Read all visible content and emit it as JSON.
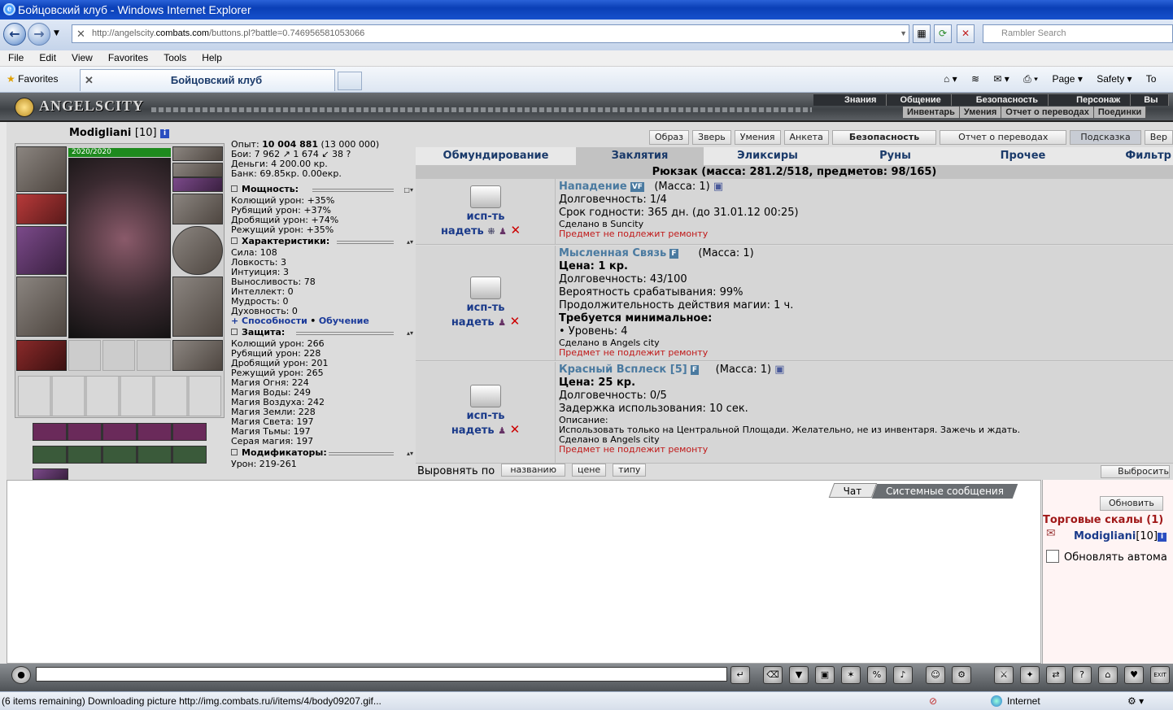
{
  "window": {
    "title": "Бойцовский клуб - Windows Internet Explorer"
  },
  "browser": {
    "url_prefix": "http://angelscity.",
    "url_domain": "combats.com",
    "url_rest": "/buttons.pl?battle=0.746956581053066",
    "search_placeholder": "Rambler Search",
    "menu": [
      "File",
      "Edit",
      "View",
      "Favorites",
      "Tools",
      "Help"
    ],
    "favorites_label": "Favorites",
    "tab_title": "Бойцовский клуб",
    "commands": [
      "Page ▾",
      "Safety ▾",
      "To"
    ]
  },
  "game": {
    "logo": "ANGELSCITY",
    "top_menu": [
      "Знания",
      "Общение",
      "Безопасность",
      "Персонаж",
      "Вы"
    ],
    "sub_menu": [
      "Инвентарь",
      "Умения",
      "Отчет о переводах",
      "Поединки"
    ],
    "buttons": [
      "Образ",
      "Зверь",
      "Умения",
      "Анкета",
      "Безопасность",
      "Отчет о переводах",
      "Подсказка",
      "Вер"
    ]
  },
  "character": {
    "name": "Modigliani",
    "level": "[10]",
    "hp": "2020/2020",
    "exp_label": "Опыт:",
    "exp": "10 004 881",
    "exp_next": "(13 000 000)",
    "fights": "Бои:   7 962 ↗  1 674 ↙  38 ?",
    "money": "Деньги: 4 200.00 кр.",
    "bank": "Банк: 69.85кр. 0.00екр."
  },
  "sections": {
    "power": {
      "title": "Мощность:",
      "rows": [
        "Колющий урон: +35%",
        "Рубящий урон: +37%",
        "Дробящий урон: +74%",
        "Режущий урон: +35%"
      ]
    },
    "chars": {
      "title": "Характеристики:",
      "rows": [
        "Сила: 108",
        "Ловкость: 3",
        "Интуиция: 3",
        "Выносливость: 78",
        "Интеллект: 0",
        "Мудрость: 0",
        "Духовность: 0"
      ],
      "links": [
        "+ Способности",
        "Обучение"
      ]
    },
    "defense": {
      "title": "Защита:",
      "rows": [
        "Колющий урон: 266",
        "Рубящий урон: 228",
        "Дробящий урон: 201",
        "Режущий урон: 265",
        "Магия Огня: 224",
        "Магия Воды: 249",
        "Магия Воздуха: 242",
        "Магия Земли: 228",
        "Магия Света: 197",
        "Магия Тьмы: 197",
        "Серая магия: 197"
      ]
    },
    "mods": {
      "title": "Модификаторы:",
      "rows": [
        "Урон: 219-261"
      ]
    }
  },
  "inventory": {
    "tabs": [
      "Обмундирование",
      "Заклятия",
      "Эликсиры",
      "Руны",
      "Прочее",
      "Фильтр"
    ],
    "active_tab": "Заклятия",
    "pack": "Рюкзак (масса: 281.2/518, предметов: 98/165)",
    "use": "исп-ть",
    "wear": "надеть",
    "items": [
      {
        "name": "Нападение",
        "tag": "VF",
        "mass": "(Масса: 1)",
        "lines": [
          "Долговечность: 1/4",
          "Срок годности: 365 дн. (до 31.01.12 00:25)"
        ],
        "made": "Сделано в Suncity",
        "repair": "Предмет не подлежит ремонту"
      },
      {
        "name": "Мысленная Связь",
        "tag": "F",
        "mass": "(Масса: 1)",
        "price": "Цена: 1 кр.",
        "lines": [
          "Долговечность: 43/100",
          "Вероятность срабатывания: 99%",
          "Продолжительность действия магии: 1 ч."
        ],
        "req_title": "Требуется минимальное:",
        "req": "• Уровень: 4",
        "made": "Сделано в Angels city",
        "repair": "Предмет не подлежит ремонту"
      },
      {
        "name": "Красный Всплеск [5]",
        "tag": "F",
        "mass": "(Масса: 1)",
        "price": "Цена: 25 кр.",
        "lines": [
          "Долговечность: 0/5",
          "Задержка использования: 10 сек."
        ],
        "desc_title": "Описание:",
        "desc": "Использовать только на Центральной Площади. Желательно, не из инвентаря. Зажечь и ждать.",
        "made": "Сделано в Angels city",
        "repair": "Предмет не подлежит ремонту"
      }
    ],
    "sort_label": "Выровнять по",
    "sort_options": [
      "названию",
      "цене",
      "типу"
    ],
    "discard": "Выбросить"
  },
  "chat": {
    "tabs": [
      "Чат",
      "Системные сообщения"
    ],
    "refresh": "Обновить",
    "room": "Торговые скалы (1)",
    "user": "Modigliani",
    "user_level": "[10]",
    "auto_refresh": "Обновлять автома"
  },
  "status": {
    "text": "(6 items remaining) Downloading picture http://img.combats.ru/i/items/4/body09207.gif...",
    "zone": "Internet"
  }
}
